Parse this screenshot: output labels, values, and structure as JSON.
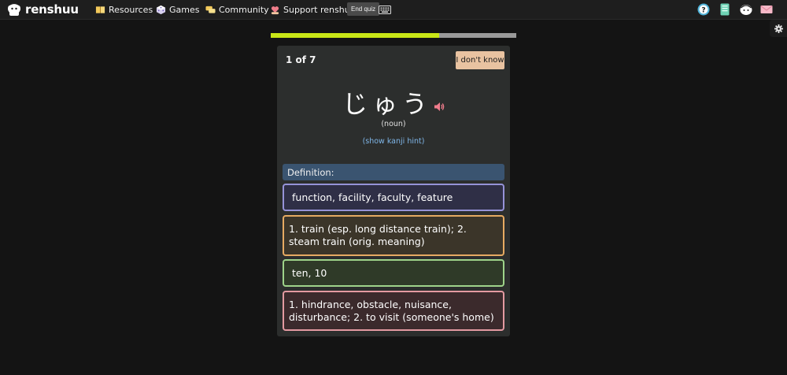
{
  "navbar": {
    "brand": "renshuu",
    "links": [
      {
        "label": "Resources",
        "icon": "book-icon"
      },
      {
        "label": "Games",
        "icon": "dice-icon"
      },
      {
        "label": "Community",
        "icon": "chat-bubbles-icon"
      },
      {
        "label": "Support renshuu",
        "icon": "heart-hands-icon"
      }
    ],
    "end_quiz_label": "End quiz",
    "right_icons": [
      "help-icon",
      "notebook-icon",
      "mascot-icon",
      "mail-icon"
    ]
  },
  "progress": {
    "fraction": 0.685
  },
  "quiz": {
    "counter": "1 of 7",
    "dont_know_label": "I don't know",
    "term": "じゅう",
    "part_of_speech": "(noun)",
    "kanji_hint_label": "(show kanji hint)",
    "definition_label": "Definition:",
    "options": [
      "function, facility, faculty, feature",
      "1. train (esp. long distance train); 2. steam train (orig. meaning)",
      "ten, 10",
      "1. hindrance, obstacle, nuisance, disturbance; 2. to visit (someone's home)"
    ]
  },
  "colors": {
    "progress_fill": "#c9e617",
    "progress_track": "#9a9a9a",
    "idk_button": "#e9c3a1",
    "definition_header": "#3a5470",
    "option_borders": [
      "#9693d8",
      "#e6aa62",
      "#9ed38a",
      "#e39aa1"
    ]
  }
}
